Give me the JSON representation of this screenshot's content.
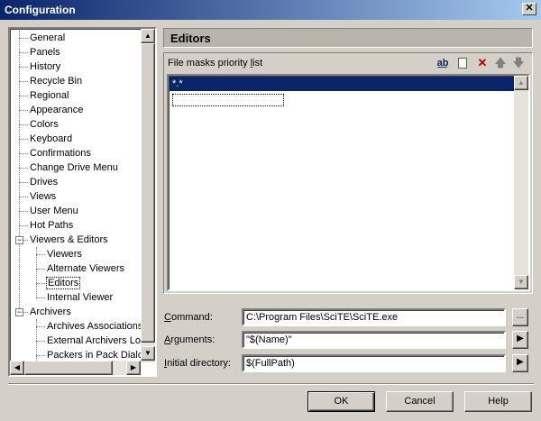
{
  "window": {
    "title": "Configuration"
  },
  "tree": {
    "items": [
      {
        "label": "General"
      },
      {
        "label": "Panels"
      },
      {
        "label": "History"
      },
      {
        "label": "Recycle Bin"
      },
      {
        "label": "Regional"
      },
      {
        "label": "Appearance"
      },
      {
        "label": "Colors"
      },
      {
        "label": "Keyboard"
      },
      {
        "label": "Confirmations"
      },
      {
        "label": "Change Drive Menu"
      },
      {
        "label": "Drives"
      },
      {
        "label": "Views"
      },
      {
        "label": "User Menu"
      },
      {
        "label": "Hot Paths"
      },
      {
        "label": "Viewers & Editors",
        "expander": "−"
      },
      {
        "label": "Viewers"
      },
      {
        "label": "Alternate Viewers"
      },
      {
        "label": "Editors"
      },
      {
        "label": "Internal Viewer"
      },
      {
        "label": "Archivers",
        "expander": "−"
      },
      {
        "label": "Archives Associations"
      },
      {
        "label": "External Archivers Loc"
      },
      {
        "label": "Packers in Pack Dialo"
      }
    ]
  },
  "panel": {
    "title": "Editors",
    "list_label_pre": "File masks priority ",
    "list_label_ul": "l",
    "list_label_post": "ist",
    "list_items": [
      "*.*"
    ]
  },
  "fields": {
    "command": {
      "label_pre": "",
      "label_ul": "C",
      "label_post": "ommand:",
      "value": "C:\\Program Files\\SciTE\\SciTE.exe",
      "button": "..."
    },
    "arguments": {
      "label_pre": "",
      "label_ul": "A",
      "label_post": "rguments:",
      "value": "\"$(Name)\"",
      "button": "▶"
    },
    "initial_directory": {
      "label_pre": "",
      "label_ul": "I",
      "label_post": "nitial directory:",
      "value": "$(FullPath)",
      "button": "▶"
    }
  },
  "buttons": {
    "ok": "OK",
    "cancel": "Cancel",
    "help": "Help"
  },
  "icons": {
    "rename": "abc-rename-icon",
    "new": "new-item-icon",
    "delete": "delete-x-icon",
    "up": "arrow-up-icon",
    "down": "arrow-down-icon"
  }
}
